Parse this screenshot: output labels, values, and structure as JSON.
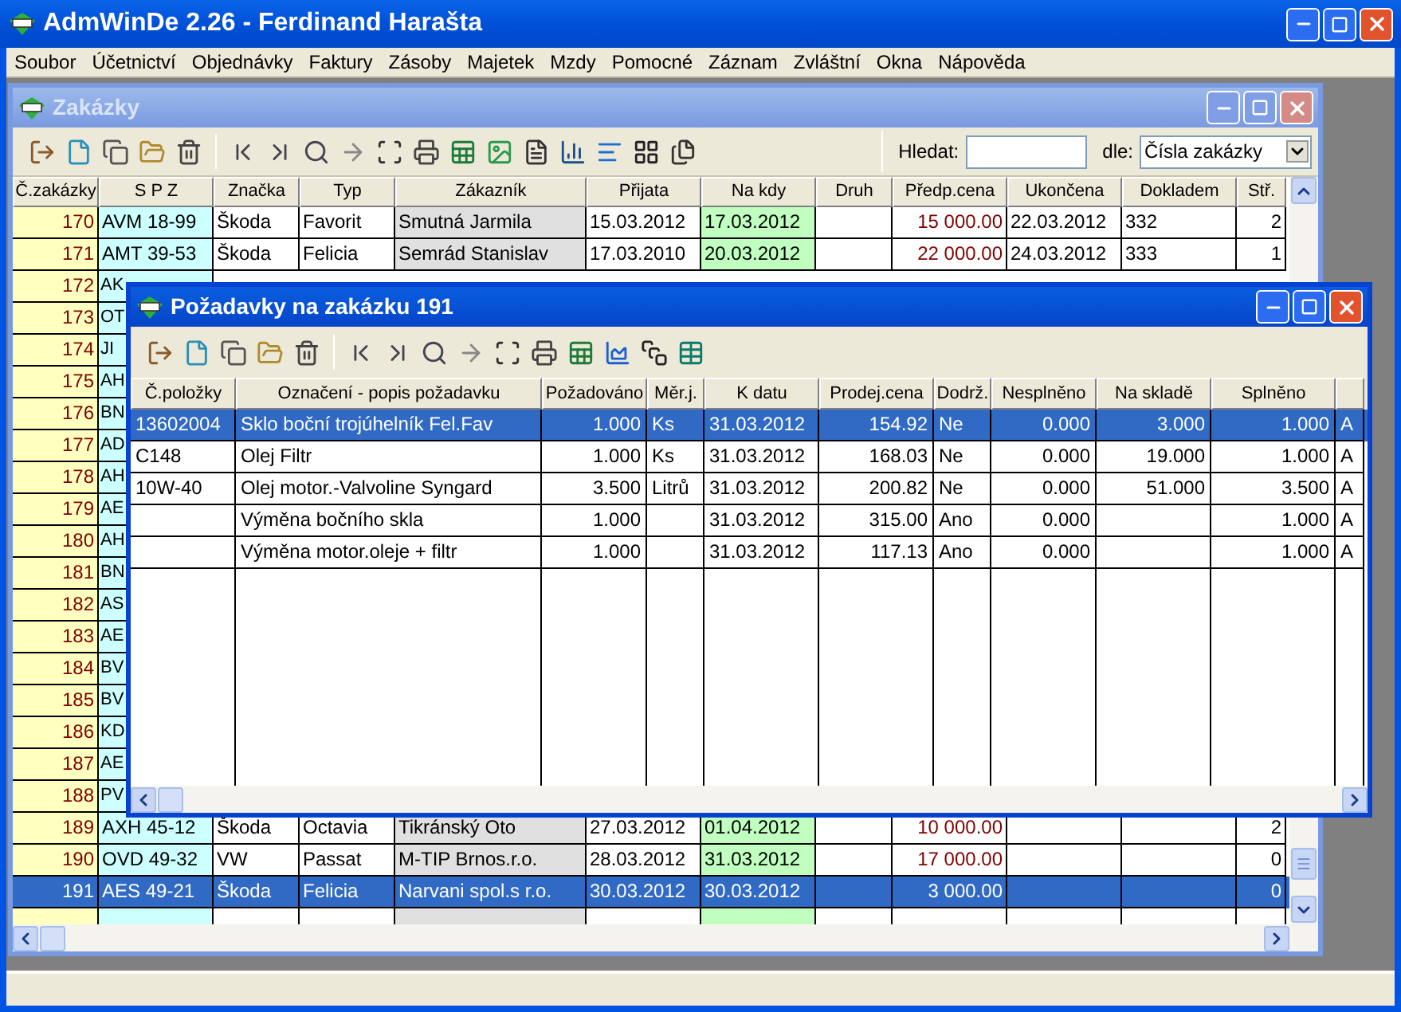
{
  "window": {
    "title": "AdmWinDe 2.26 - Ferdinand Harašta"
  },
  "menu": [
    "Soubor",
    "Účetnictví",
    "Objednávky",
    "Faktury",
    "Zásoby",
    "Majetek",
    "Mzdy",
    "Pomocné",
    "Záznam",
    "Zvláštní",
    "Okna",
    "Nápověda"
  ],
  "orders_window": {
    "title": "Zakázky",
    "active": false,
    "search_label": "Hledat:",
    "by_label": "dle:",
    "by_value": "Čísla zakázky",
    "columns": [
      "Č.zakázky",
      "S P Z",
      "Značka",
      "Typ",
      "Zákazník",
      "Přijata",
      "Na kdy",
      "Druh",
      "Předp.cena",
      "Ukončena",
      "Dokladem",
      "Stř."
    ],
    "rows": [
      {
        "selected": false,
        "cells": [
          "170",
          "AVM 18-99",
          "Škoda",
          "Favorit",
          "Smutná Jarmila",
          "15.03.2012",
          "17.03.2012",
          null,
          "15 000.00",
          "22.03.2012",
          "332",
          "2"
        ]
      },
      {
        "selected": false,
        "cells": [
          "171",
          "AMT 39-53",
          "Škoda",
          "Felicia",
          "Semrád Stanislav",
          "17.03.2010",
          "20.03.2012",
          null,
          "22 000.00",
          "24.03.2012",
          "333",
          "1"
        ]
      },
      {
        "selected": false,
        "cells": [
          "172",
          "AK"
        ]
      },
      {
        "selected": false,
        "cells": [
          "173",
          "OT"
        ]
      },
      {
        "selected": false,
        "cells": [
          "174",
          "JI"
        ]
      },
      {
        "selected": false,
        "cells": [
          "175",
          "AH"
        ]
      },
      {
        "selected": false,
        "cells": [
          "176",
          "BN"
        ]
      },
      {
        "selected": false,
        "cells": [
          "177",
          "AD"
        ]
      },
      {
        "selected": false,
        "cells": [
          "178",
          "AH"
        ]
      },
      {
        "selected": false,
        "cells": [
          "179",
          "AE"
        ]
      },
      {
        "selected": false,
        "cells": [
          "180",
          "AH"
        ]
      },
      {
        "selected": false,
        "cells": [
          "181",
          "BN"
        ]
      },
      {
        "selected": false,
        "cells": [
          "182",
          "AS"
        ]
      },
      {
        "selected": false,
        "cells": [
          "183",
          "AE"
        ]
      },
      {
        "selected": false,
        "cells": [
          "184",
          "BV"
        ]
      },
      {
        "selected": false,
        "cells": [
          "185",
          "BV"
        ]
      },
      {
        "selected": false,
        "cells": [
          "186",
          "KD"
        ]
      },
      {
        "selected": false,
        "cells": [
          "187",
          "AE"
        ]
      },
      {
        "selected": false,
        "cells": [
          "188",
          "PV"
        ]
      },
      {
        "selected": false,
        "cells": [
          "189",
          "AXH 45-12",
          "Škoda",
          "Octavia",
          "Tikránský Oto",
          "27.03.2012",
          "01.04.2012",
          null,
          "10 000.00",
          null,
          null,
          "2"
        ]
      },
      {
        "selected": false,
        "cells": [
          "190",
          "OVD 49-32",
          "VW",
          "Passat",
          "M-TIP Brnos.r.o.",
          "28.03.2012",
          "31.03.2012",
          null,
          "17 000.00",
          null,
          null,
          "0"
        ]
      },
      {
        "selected": true,
        "cells": [
          "191",
          "AES 49-21",
          "Škoda",
          "Felicia",
          "Narvani spol.s r.o.",
          "30.03.2012",
          "30.03.2012",
          null,
          "3 000.00",
          null,
          null,
          "0"
        ]
      }
    ]
  },
  "requests_window": {
    "title": "Požadavky na zakázku 191",
    "active": true,
    "columns": [
      "Č.položky",
      "Označení - popis požadavku",
      "Požadováno",
      "Měr.j.",
      "K datu",
      "Prodej.cena",
      "Dodrž.",
      "Nesplněno",
      "Na skladě",
      "Splněno"
    ],
    "rows": [
      {
        "selected": true,
        "cells": [
          "13602004",
          "Sklo boční trojúhelník Fel.Fav",
          "1.000",
          "Ks",
          "31.03.2012",
          "154.92",
          "Ne",
          "0.000",
          "3.000",
          "1.000",
          "A"
        ]
      },
      {
        "selected": false,
        "cells": [
          "C148",
          "Olej Filtr",
          "1.000",
          "Ks",
          "31.03.2012",
          "168.03",
          "Ne",
          "0.000",
          "19.000",
          "1.000",
          "A"
        ]
      },
      {
        "selected": false,
        "cells": [
          "10W-40",
          "Olej motor.-Valvoline Syngard",
          "3.500",
          "Litrů",
          "31.03.2012",
          "200.82",
          "Ne",
          "0.000",
          "51.000",
          "3.500",
          "A"
        ]
      },
      {
        "selected": false,
        "cells": [
          null,
          "Výměna bočního skla",
          "1.000",
          null,
          "31.03.2012",
          "315.00",
          "Ano",
          "0.000",
          null,
          "1.000",
          "A"
        ]
      },
      {
        "selected": false,
        "cells": [
          null,
          "Výměna motor.oleje + filtr",
          "1.000",
          null,
          "31.03.2012",
          "117.13",
          "Ano",
          "0.000",
          null,
          "1.000",
          "A"
        ]
      }
    ]
  }
}
